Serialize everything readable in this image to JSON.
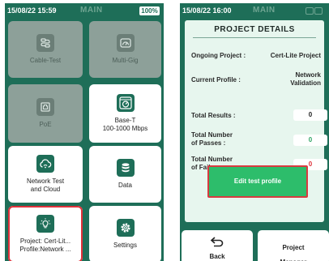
{
  "left_screen": {
    "status": {
      "time": "15/08/22 15:59",
      "title": "MAIN",
      "battery": "100%"
    },
    "tiles": [
      {
        "label": "Cable-Test",
        "icon": "cable-icon",
        "enabled": false
      },
      {
        "label": "Multi-Gig",
        "icon": "gauge-icon",
        "enabled": false
      },
      {
        "label": "PoE",
        "icon": "ethernet-port-icon",
        "enabled": false
      },
      {
        "label": "Base-T\n100-1000 Mbps",
        "icon": "speedometer-icon",
        "enabled": true
      },
      {
        "label": "Network Test\nand Cloud",
        "icon": "cloud-icon",
        "enabled": true
      },
      {
        "label": "Data",
        "icon": "database-icon",
        "enabled": true
      },
      {
        "label": "Project: Cert-Lit...\nProfile:Network ...",
        "icon": "lightbulb-icon",
        "enabled": true,
        "selected": true
      },
      {
        "label": "Settings",
        "icon": "gear-icon",
        "enabled": true
      }
    ]
  },
  "right_screen": {
    "status": {
      "time": "15/08/22 16:00",
      "title": "MAIN"
    },
    "panel_title": "PROJECT DETAILS",
    "ongoing_project_label": "Ongoing Project :",
    "ongoing_project_value": "Cert-Lite Project",
    "current_profile_label": "Current Profile :",
    "current_profile_value": "Network\nValidation",
    "total_results_label": "Total Results :",
    "total_results_value": "0",
    "total_passes_label": "Total Number\nof Passes :",
    "total_passes_value": "0",
    "total_failures_label": "Total Number\nof Failures :",
    "total_failures_value": "0",
    "edit_button_label": "Edit test profile",
    "back_label": "Back",
    "project_manager_label": "Project\nManager"
  },
  "colors": {
    "background": "#1e6e58",
    "panel": "#e7f6ee",
    "accent_green": "#2dbd6b",
    "pass_green": "#2fa464",
    "fail_red": "#e0313a",
    "disabled_tile": "#8da099"
  }
}
